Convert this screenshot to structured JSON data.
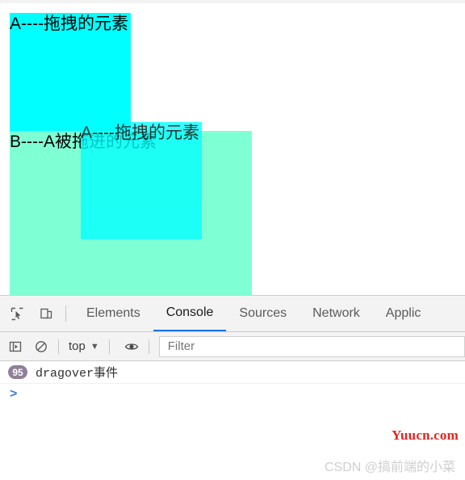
{
  "page": {
    "box_a": {
      "label": "A----拖拽的元素",
      "color": "#00ffff"
    },
    "box_b": {
      "label": "B----A被拖进的元素",
      "color": "#7fffd4"
    },
    "drag_ghost": {
      "label": "A----拖拽的元素",
      "color": "#00ffff"
    }
  },
  "devtools": {
    "tabbar": {
      "inspect_icon": "inspect-element-icon",
      "device_icon": "device-toolbar-icon",
      "tabs": [
        {
          "label": "Elements",
          "active": false
        },
        {
          "label": "Console",
          "active": true
        },
        {
          "label": "Sources",
          "active": false
        },
        {
          "label": "Network",
          "active": false
        },
        {
          "label": "Applic",
          "active": false
        }
      ]
    },
    "toolbar": {
      "sidebar_icon": "console-sidebar-icon",
      "clear_icon": "clear-console-icon",
      "context": "top",
      "context_caret": "▼",
      "eye_icon": "live-expression-eye-icon",
      "filter_placeholder": "Filter",
      "filter_value": ""
    },
    "console": {
      "messages": [
        {
          "repeat_count": "95",
          "text": "dragover事件",
          "badge_color": "#8f8098"
        }
      ],
      "prompt": ">"
    }
  },
  "watermarks": {
    "yuucn": "Yuucn.com",
    "csdn": "CSDN @搞前端的小菜"
  }
}
